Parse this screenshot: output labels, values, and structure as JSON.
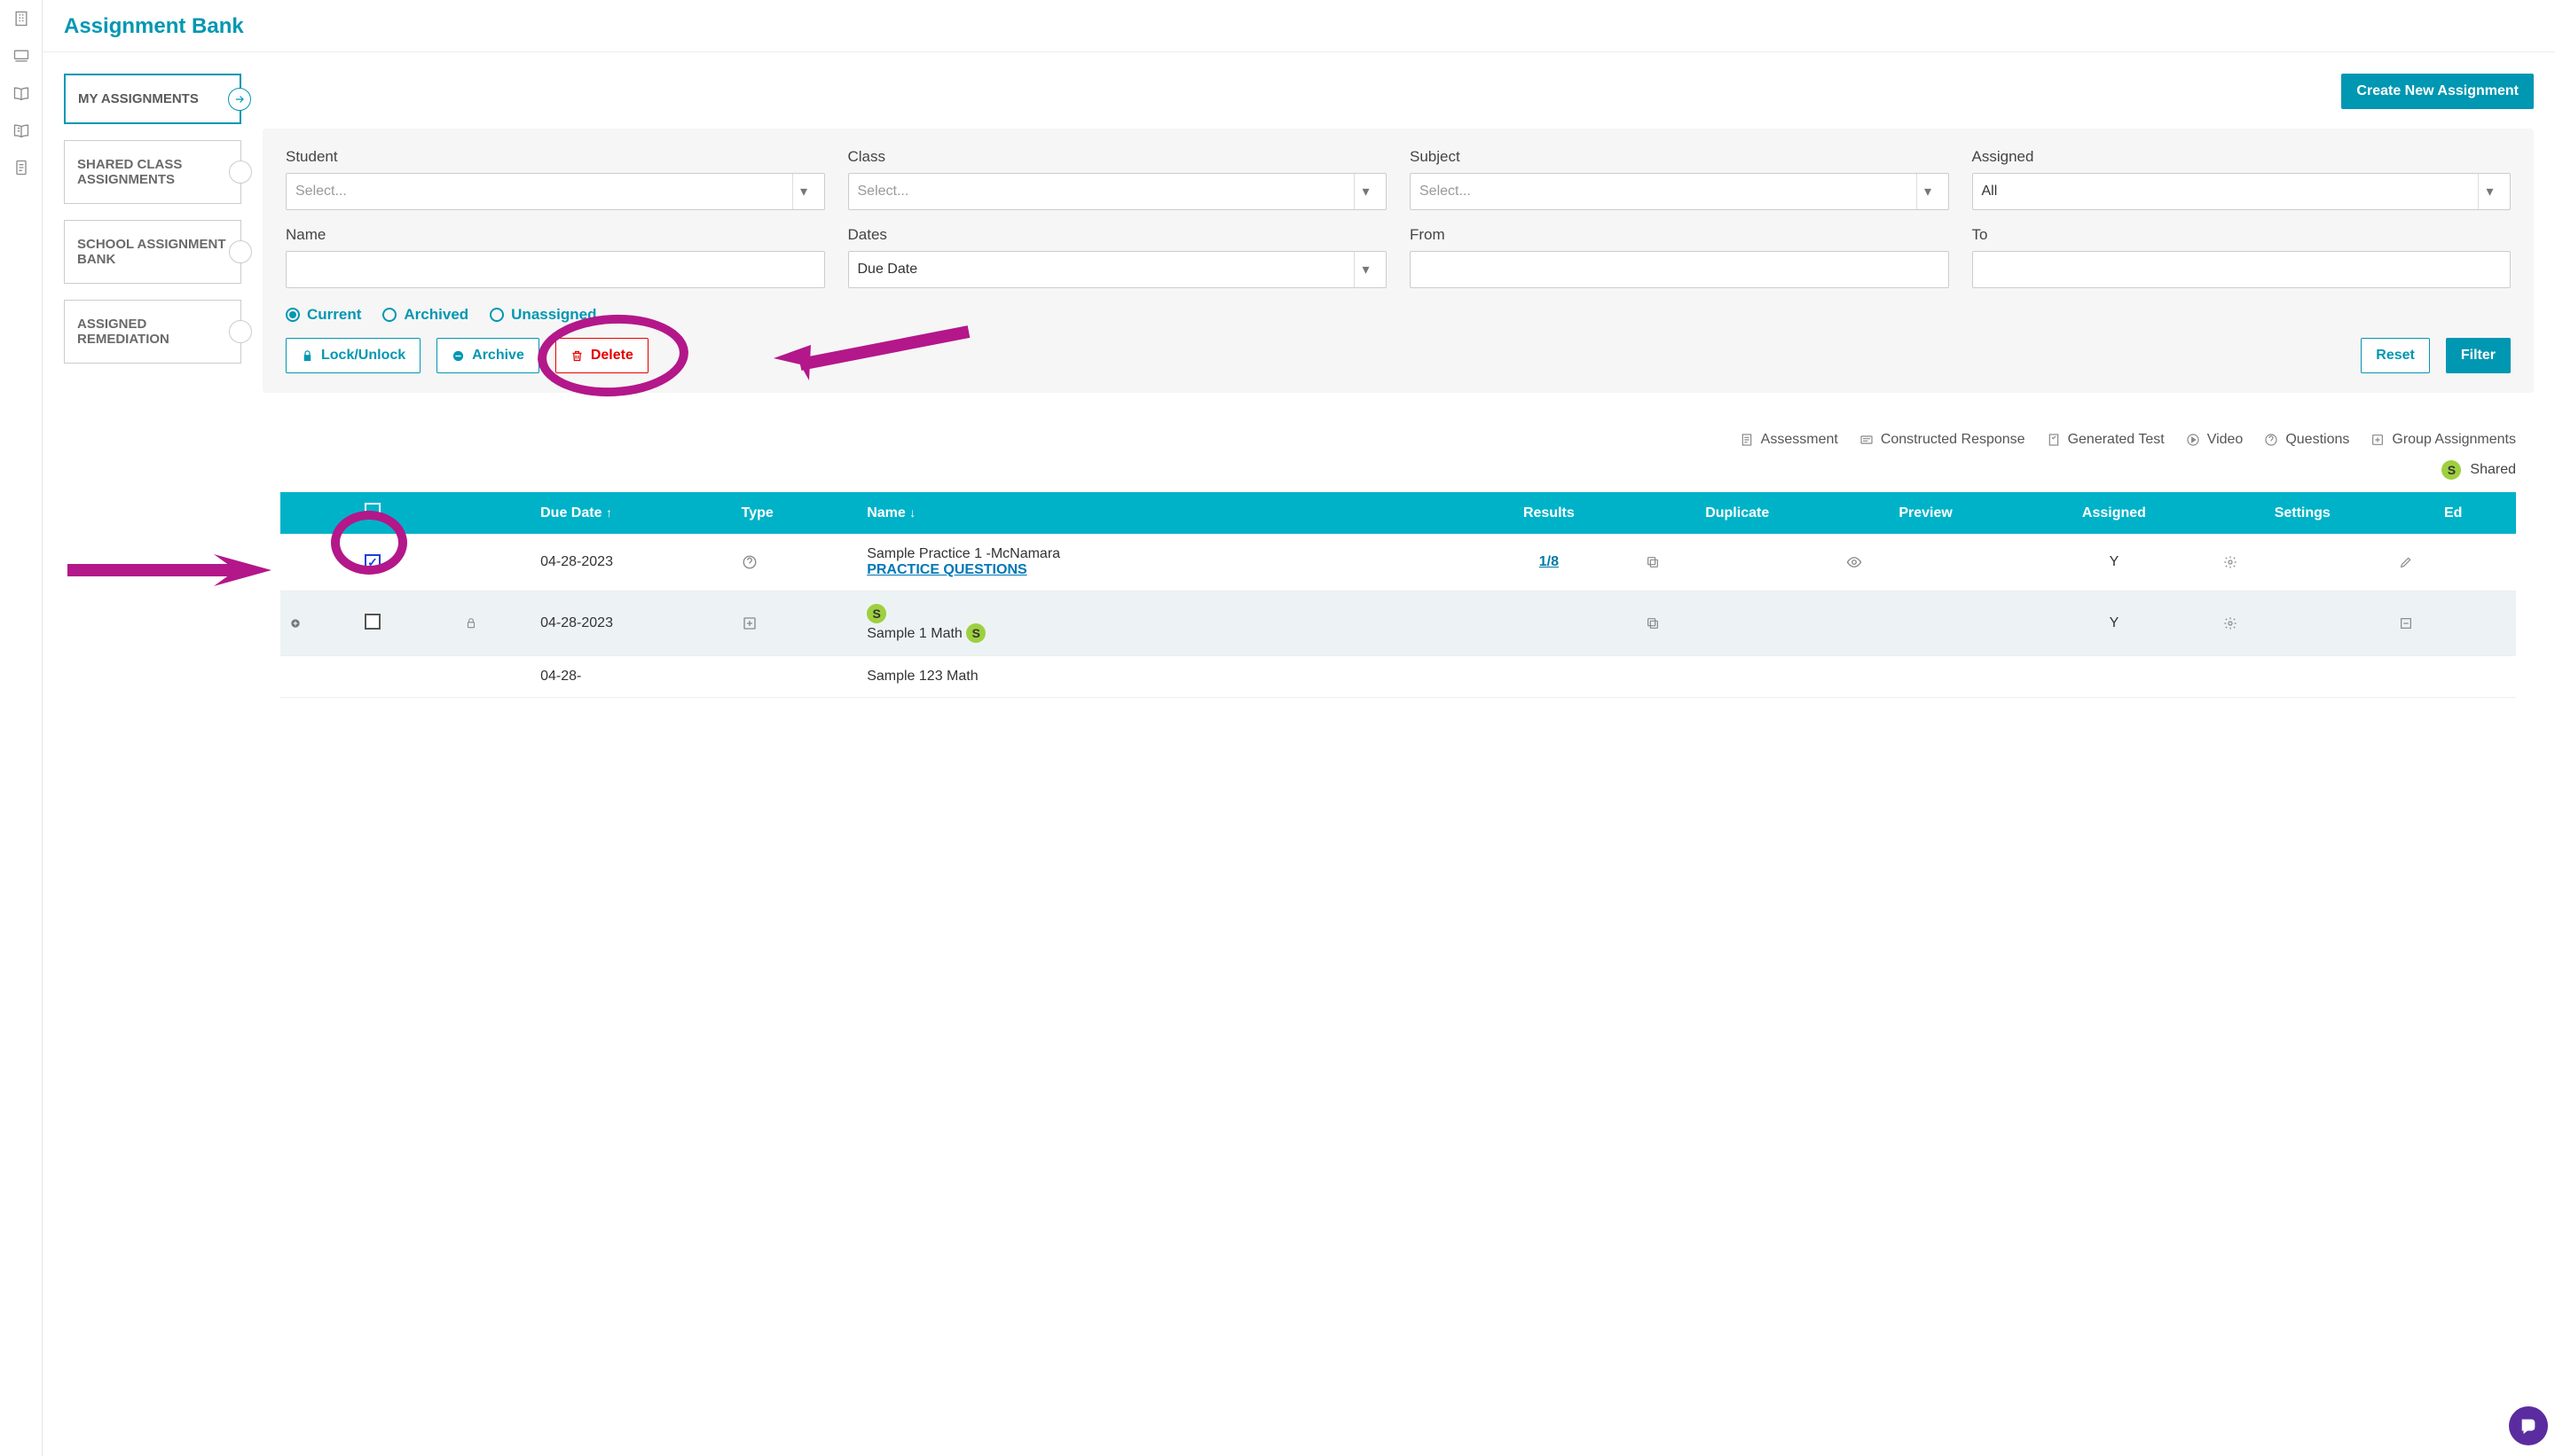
{
  "colors": {
    "teal": "#0097b2",
    "tealHeader": "#00b2c8",
    "red": "#e40000",
    "magenta": "#b3178a",
    "purple": "#5a2ca0",
    "green": "#9ecf3f"
  },
  "pageTitle": "Assignment Bank",
  "createButton": "Create New Assignment",
  "sideTabs": [
    {
      "label": "MY ASSIGNMENTS",
      "active": true
    },
    {
      "label": "SHARED CLASS ASSIGNMENTS",
      "active": false
    },
    {
      "label": "SCHOOL ASSIGNMENT BANK",
      "active": false
    },
    {
      "label": "ASSIGNED REMEDIATION",
      "active": false
    }
  ],
  "filters": {
    "student": {
      "label": "Student",
      "placeholder": "Select..."
    },
    "class_": {
      "label": "Class",
      "placeholder": "Select..."
    },
    "subject": {
      "label": "Subject",
      "placeholder": "Select..."
    },
    "assigned": {
      "label": "Assigned",
      "value": "All"
    },
    "name": {
      "label": "Name"
    },
    "dates": {
      "label": "Dates",
      "value": "Due Date"
    },
    "from": {
      "label": "From"
    },
    "to": {
      "label": "To"
    }
  },
  "radios": {
    "current": "Current",
    "archived": "Archived",
    "unassigned": "Unassigned",
    "selected": "current"
  },
  "actionButtons": {
    "lock": "Lock/Unlock",
    "archive": "Archive",
    "delete": "Delete",
    "reset": "Reset",
    "filter": "Filter"
  },
  "legend": {
    "assessment": "Assessment",
    "constructed": "Constructed Response",
    "generated": "Generated Test",
    "video": "Video",
    "questions": "Questions",
    "group": "Group Assignments",
    "shared": "Shared",
    "sharedBadge": "S"
  },
  "table": {
    "headers": {
      "dueDate": "Due Date",
      "type": "Type",
      "name": "Name",
      "results": "Results",
      "duplicate": "Duplicate",
      "preview": "Preview",
      "assigned": "Assigned",
      "settings": "Settings",
      "edit": "Ed"
    },
    "rows": [
      {
        "checked": true,
        "expandable": false,
        "locked": false,
        "due": "04-28-2023",
        "typeIcon": "questions",
        "name": "Sample Practice 1 -McNamara",
        "sub": "PRACTICE QUESTIONS",
        "sharedBadge": false,
        "results": "1/8",
        "assigned": "Y"
      },
      {
        "checked": false,
        "expandable": true,
        "locked": true,
        "due": "04-28-2023",
        "typeIcon": "group",
        "name": "Sample 1 Math",
        "sharedBadge": true,
        "leadingBadge": true,
        "results": "",
        "assigned": "Y"
      },
      {
        "checked": false,
        "expandable": false,
        "locked": false,
        "due": "04-28-",
        "typeIcon": "",
        "name": "Sample 123 Math",
        "sharedBadge": false,
        "results": "",
        "assigned": ""
      }
    ]
  }
}
